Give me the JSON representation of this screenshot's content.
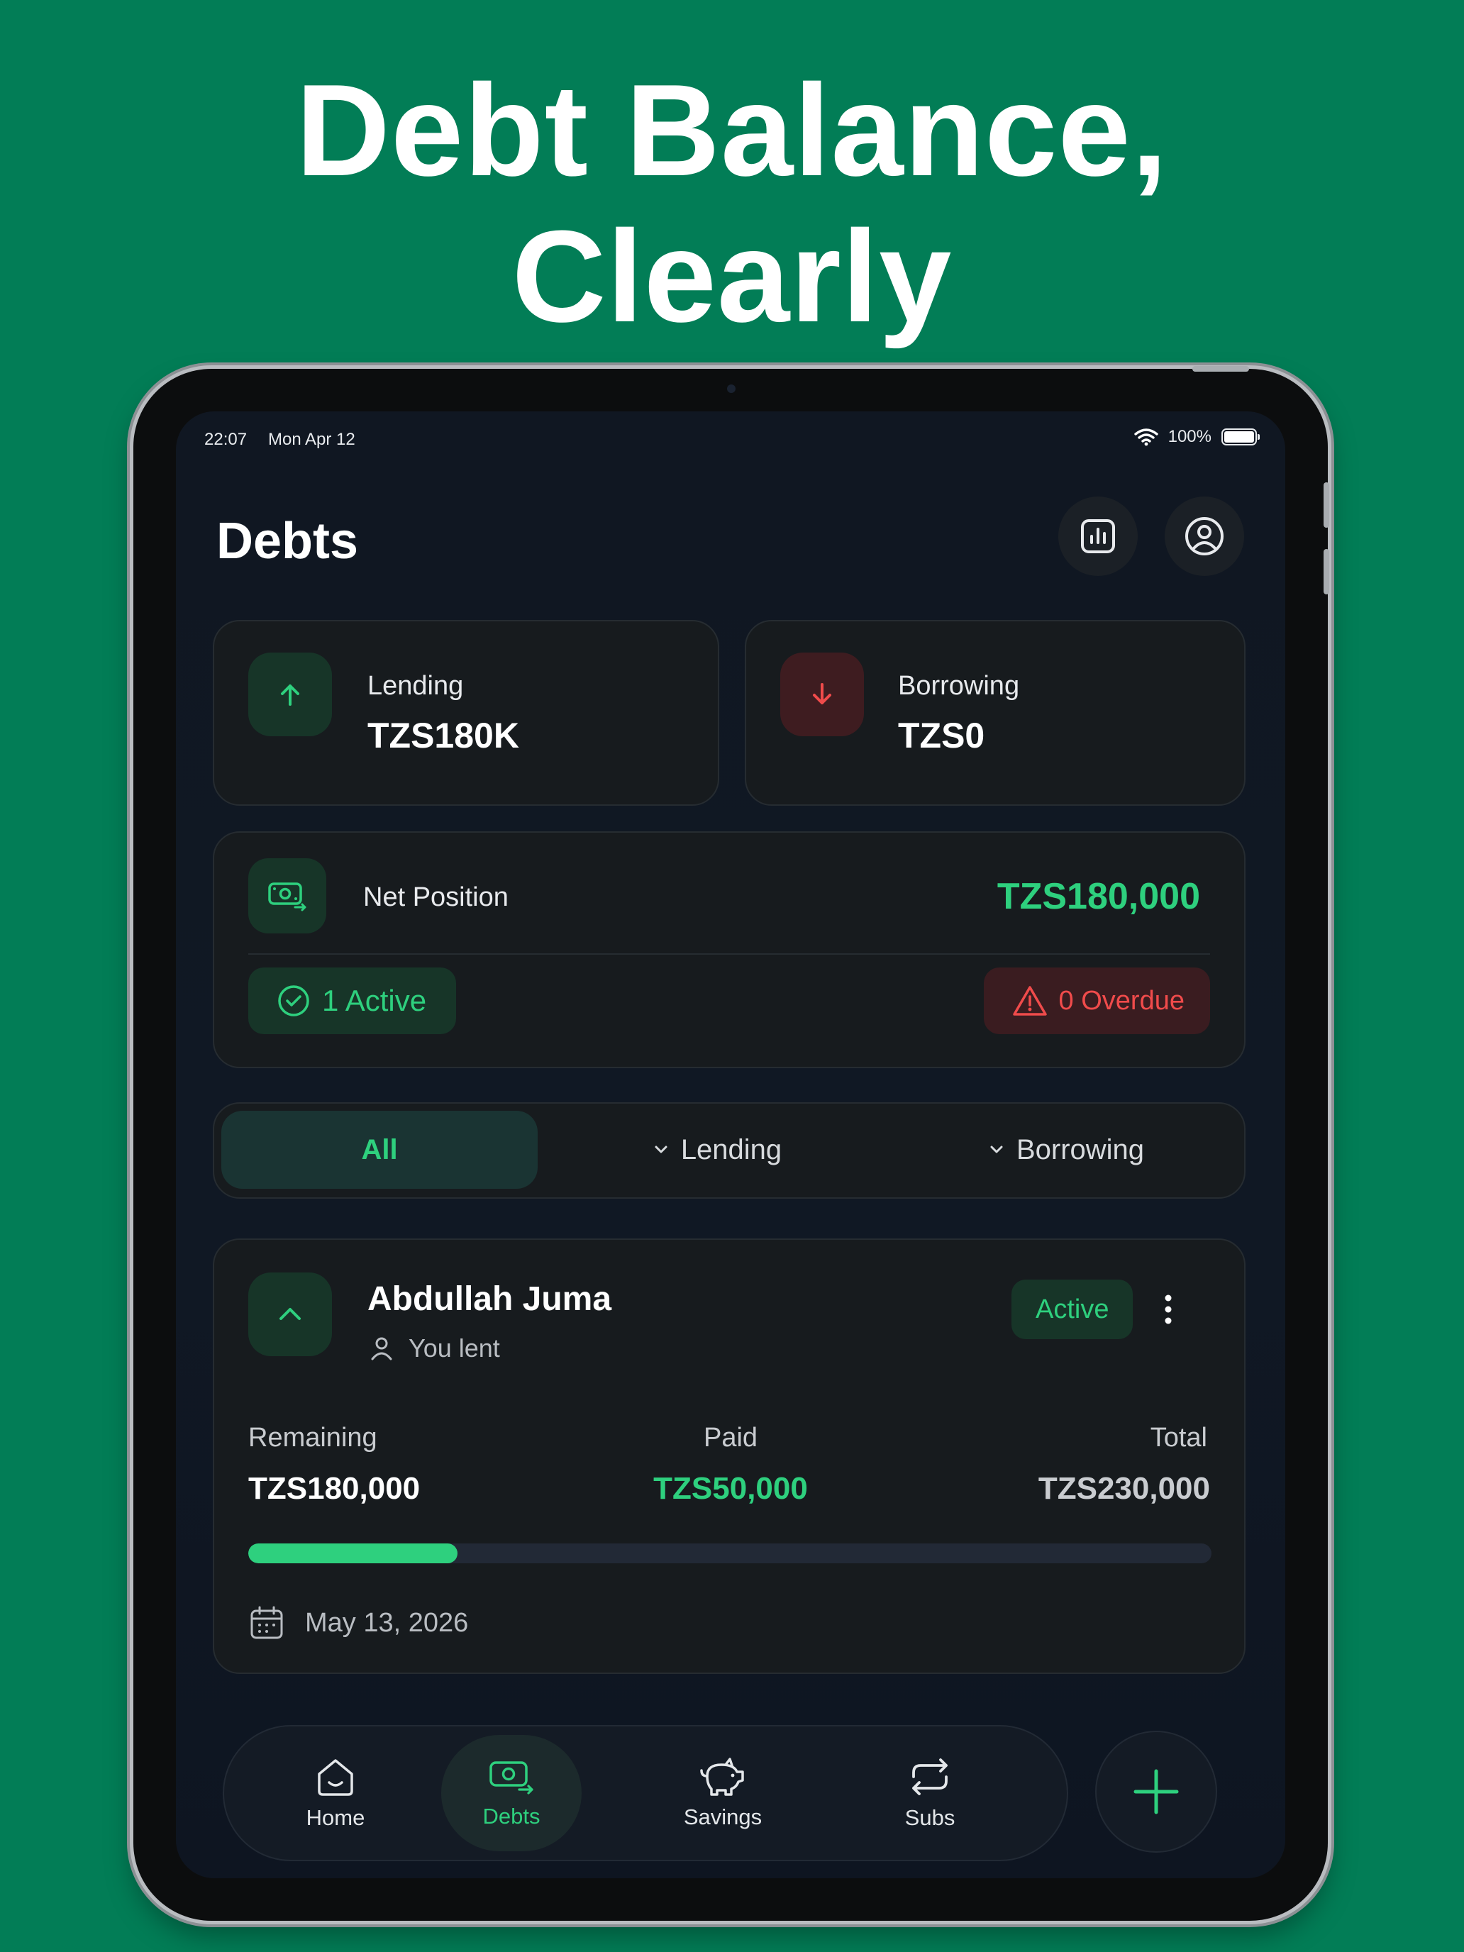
{
  "headline": {
    "line1": "Debt Balance,",
    "line2": "Clearly"
  },
  "status_bar": {
    "time": "22:07",
    "date": "Mon Apr 12",
    "battery": "100%",
    "battery_level": 1.0
  },
  "header": {
    "title": "Debts",
    "stats_icon": "bar-chart-icon",
    "profile_icon": "user-circle-icon"
  },
  "summary": {
    "lending": {
      "label": "Lending",
      "value": "TZS180K",
      "icon": "arrow-up-icon"
    },
    "borrowing": {
      "label": "Borrowing",
      "value": "TZS0",
      "icon": "arrow-down-icon"
    }
  },
  "net_position": {
    "label": "Net Position",
    "value": "TZS180,000",
    "active_label": "1 Active",
    "overdue_label": "0 Overdue"
  },
  "filters": {
    "all": "All",
    "lending": "Lending",
    "borrowing": "Borrowing",
    "selected": "All"
  },
  "debt": {
    "name": "Abdullah Juma",
    "subtitle": "You lent",
    "status": "Active",
    "remaining_label": "Remaining",
    "remaining_value": "TZS180,000",
    "paid_label": "Paid",
    "paid_value": "TZS50,000",
    "total_label": "Total",
    "total_value": "TZS230,000",
    "progress": 0.217,
    "due_date": "May 13, 2026"
  },
  "nav": {
    "home": "Home",
    "debts": "Debts",
    "savings": "Savings",
    "subs": "Subs",
    "active": "Debts"
  },
  "colors": {
    "background": "#027d56",
    "accent_green": "#2ed07e",
    "danger_red": "#f04b4b",
    "card": "#171b1e",
    "screen": "#101722"
  }
}
